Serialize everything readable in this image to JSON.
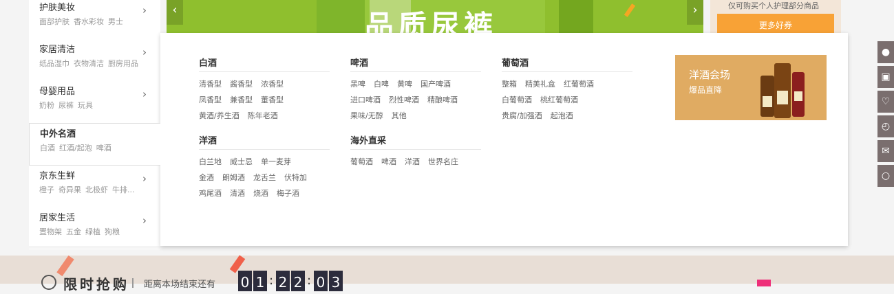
{
  "sidebar": {
    "categories": [
      {
        "title": "护肤美妆",
        "subs": [
          "面部护肤",
          "香水彩妆",
          "男士"
        ]
      },
      {
        "title": "家居清洁",
        "subs": [
          "纸品湿巾",
          "衣物清洁",
          "厨房用品"
        ]
      },
      {
        "title": "母婴用品",
        "subs": [
          "奶粉",
          "尿裤",
          "玩具"
        ]
      },
      {
        "title": "中外名酒",
        "subs": [
          "白酒",
          "红酒/起泡",
          "啤酒"
        ]
      },
      {
        "title": "京东生鲜",
        "subs": [
          "橙子",
          "奇异果",
          "北极虾",
          "牛排..."
        ]
      },
      {
        "title": "居家生活",
        "subs": [
          "置物架",
          "五金",
          "绿植",
          "狗粮"
        ]
      }
    ],
    "arrow_icon": "chevron-right"
  },
  "banner": {
    "slogan": "品质尿裤",
    "prev_icon": "‹",
    "next_icon": "›"
  },
  "coupon": {
    "text": "仅可购买个人护理部分商品",
    "button": "更多好券"
  },
  "panel": {
    "groups": [
      {
        "title": "白酒",
        "rows": [
          [
            "清香型",
            "酱香型",
            "浓香型"
          ],
          [
            "凤香型",
            "兼香型",
            "董香型"
          ],
          [
            "黄酒/养生酒",
            "陈年老酒"
          ]
        ]
      },
      {
        "title": "啤酒",
        "rows": [
          [
            "黑啤",
            "白啤",
            "黄啤",
            "国产啤酒"
          ],
          [
            "进口啤酒",
            "烈性啤酒",
            "精酿啤酒"
          ],
          [
            "果味/无醇",
            "其他"
          ]
        ]
      },
      {
        "title": "葡萄酒",
        "rows": [
          [
            "整箱",
            "精美礼盒",
            "红葡萄酒"
          ],
          [
            "白葡萄酒",
            "桃红葡萄酒"
          ],
          [
            "贵腐/加强酒",
            "起泡酒"
          ]
        ]
      },
      {
        "title": "洋酒",
        "rows": [
          [
            "白兰地",
            "威士忌",
            "单一麦芽"
          ],
          [
            "金酒",
            "朗姆酒",
            "龙舌兰",
            "伏特加"
          ],
          [
            "鸡尾酒",
            "清酒",
            "烧酒",
            "梅子酒"
          ]
        ]
      },
      {
        "title": "海外直采",
        "rows": [
          [
            "葡萄酒",
            "啤酒",
            "洋酒",
            "世界名庄"
          ]
        ]
      }
    ],
    "promo": {
      "title": "洋酒会场",
      "subtitle": "爆品直降"
    }
  },
  "toolbar": {
    "icons": [
      "user-icon",
      "cart-icon",
      "heart-icon",
      "history-icon",
      "chat-icon",
      "money-bag-icon"
    ]
  },
  "flash_sale": {
    "title": "限时抢购",
    "countdown_label": "距离本场结束还有",
    "digits": [
      "0",
      "1",
      "2",
      "2",
      "0",
      "3"
    ],
    "separator": ":"
  },
  "colors": {
    "accent_orange": "#f8a236",
    "banner_green": "#8fbf2e",
    "promo_gold": "#e0ab62",
    "toolbar_gray": "#7a6e6e"
  }
}
